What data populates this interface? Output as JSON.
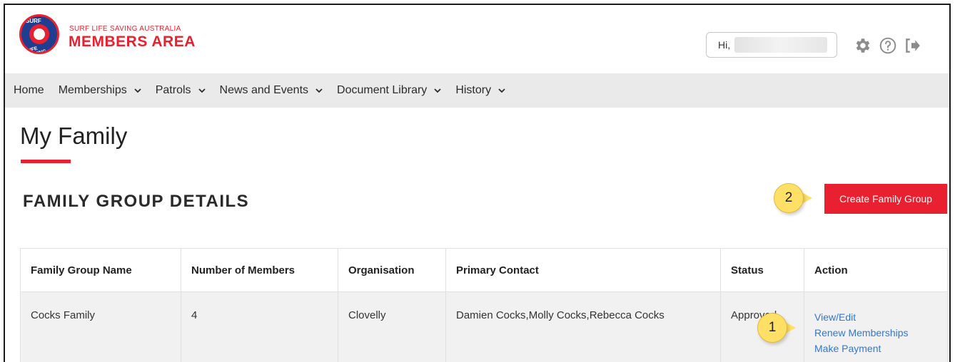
{
  "header": {
    "org_name": "SURF LIFE SAVING AUSTRALIA",
    "area_name": "MEMBERS AREA",
    "logo_top_text": "SURF",
    "logo_bottom_text": "LIFE SAVING",
    "greeting": "Hi,"
  },
  "icons": {
    "settings": "gear-icon",
    "help": "help-circle-icon",
    "logout": "logout-icon"
  },
  "nav": {
    "items": [
      {
        "label": "Home",
        "dropdown": false
      },
      {
        "label": "Memberships",
        "dropdown": true
      },
      {
        "label": "Patrols",
        "dropdown": true
      },
      {
        "label": "News and Events",
        "dropdown": true
      },
      {
        "label": "Document Library",
        "dropdown": true
      },
      {
        "label": "History",
        "dropdown": true
      }
    ]
  },
  "page": {
    "title": "My Family",
    "section_title": "FAMILY GROUP DETAILS",
    "create_button": "Create Family Group"
  },
  "callouts": {
    "one": "1",
    "two": "2"
  },
  "table": {
    "headers": [
      "Family Group Name",
      "Number of Members",
      "Organisation",
      "Primary Contact",
      "Status",
      "Action"
    ],
    "rows": [
      {
        "family_group_name": "Cocks Family",
        "number_of_members": "4",
        "organisation": "Clovelly",
        "primary_contact": "Damien Cocks,Molly Cocks,Rebecca Cocks",
        "status": "Approved",
        "actions": [
          "View/Edit",
          "Renew Memberships",
          "Make Payment"
        ]
      }
    ]
  },
  "colors": {
    "brand_red": "#e8202f",
    "brand_blue": "#1f3e8f",
    "link_blue": "#3478c6",
    "callout_yellow": "#ffe066",
    "nav_bg": "#eaeaea"
  }
}
